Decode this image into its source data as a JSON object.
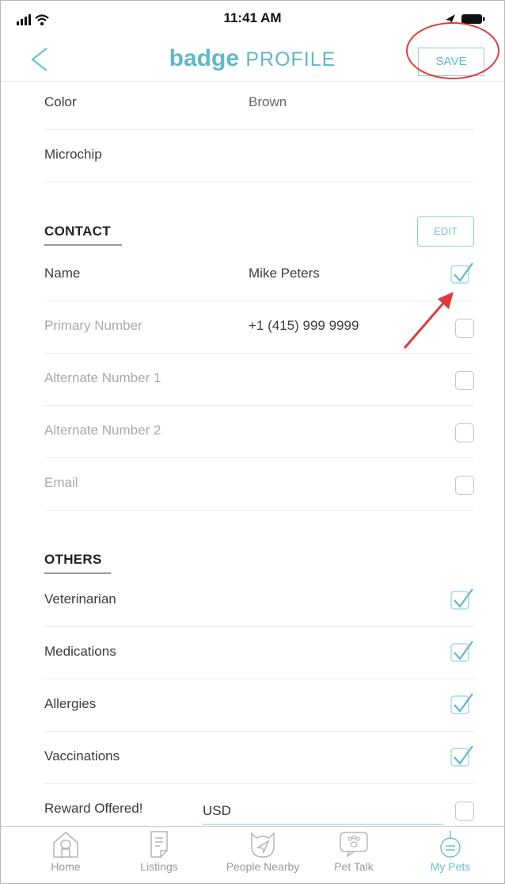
{
  "status_bar": {
    "time": "11:41 AM"
  },
  "header": {
    "brand": "badge",
    "title": "PROFILE",
    "save_label": "SAVE"
  },
  "details": [
    {
      "label": "Color",
      "value": "Brown"
    },
    {
      "label": "Microchip",
      "value": ""
    }
  ],
  "contact": {
    "heading": "CONTACT",
    "edit_label": "EDIT",
    "rows": [
      {
        "label": "Name",
        "value": "Mike Peters",
        "checked": true
      },
      {
        "label": "Primary Number",
        "value": "+1 (415) 999 9999",
        "checked": false
      },
      {
        "label": "Alternate Number 1",
        "value": "",
        "checked": false
      },
      {
        "label": "Alternate Number 2",
        "value": "",
        "checked": false
      },
      {
        "label": "Email",
        "value": "",
        "checked": false
      }
    ]
  },
  "others": {
    "heading": "OTHERS",
    "rows": [
      {
        "label": "Veterinarian",
        "checked": true
      },
      {
        "label": "Medications",
        "checked": true
      },
      {
        "label": "Allergies",
        "checked": true
      },
      {
        "label": "Vaccinations",
        "checked": true
      }
    ],
    "reward": {
      "label": "Reward Offered!",
      "currency": "USD",
      "checked": false
    }
  },
  "tabs": [
    {
      "label": "Home",
      "icon": "home-icon",
      "active": false
    },
    {
      "label": "Listings",
      "icon": "listings-icon",
      "active": false
    },
    {
      "label": "People Nearby",
      "icon": "people-nearby-icon",
      "active": false
    },
    {
      "label": "Pet Talk",
      "icon": "pet-talk-icon",
      "active": false
    },
    {
      "label": "My Pets",
      "icon": "my-pets-icon",
      "active": true
    }
  ],
  "colors": {
    "accent": "#5fb8c9",
    "annotation": "#e23a3a"
  }
}
